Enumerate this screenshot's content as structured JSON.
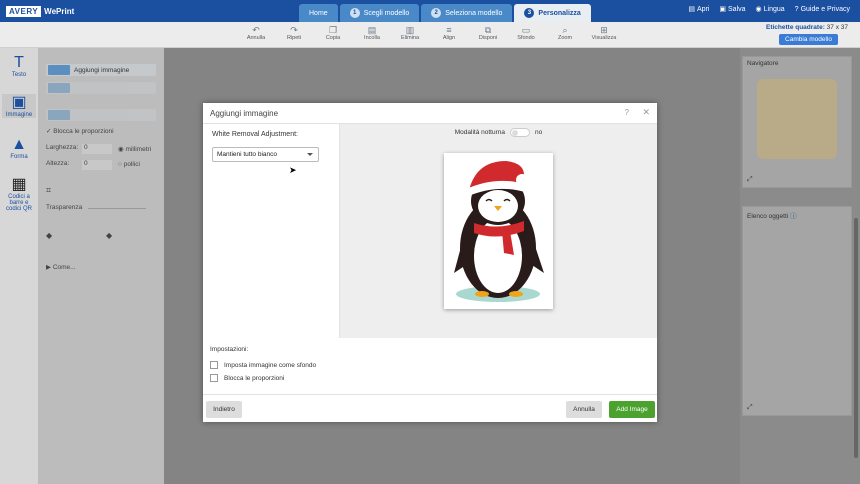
{
  "app": {
    "brand": "AVERY",
    "product": "WePrint"
  },
  "tabs": [
    {
      "label": "Home",
      "num": ""
    },
    {
      "label": "Scegli modello",
      "num": "1"
    },
    {
      "label": "Seleziona modello",
      "num": "2"
    },
    {
      "label": "Personalizza",
      "num": "3"
    }
  ],
  "topnav": {
    "open": "Apri",
    "save": "Salva",
    "language": "Lingua",
    "help": "Guide e Privacy"
  },
  "toolbar": [
    "Annulla",
    "Ripeti",
    "Copia",
    "Incolla",
    "Elimina",
    "Align",
    "Disponi",
    "Sfondo",
    "Zoom",
    "Visualizza"
  ],
  "label_info": {
    "prefix": "Etichette quadrate:",
    "size": "37 x 37"
  },
  "change_template": "Cambia modello",
  "leftbar": {
    "text": "Testo",
    "image": "Immagine",
    "shape": "Forma",
    "qr": "Codici a barre e codici QR"
  },
  "panel": {
    "add_image": "Aggiungi immagine",
    "keep_ratio": "Blocca le proporzioni",
    "width": "Larghezza:",
    "height": "Altezza:",
    "width_val": "0",
    "height_val": "0",
    "unit_mm": "millimetri",
    "unit_in": "pollici",
    "transparency": "Trasparenza",
    "howto": "Come..."
  },
  "right": {
    "navigator": "Navigatore",
    "objects": "Elenco oggetti"
  },
  "modal": {
    "title": "Aggiungi immagine",
    "help": "?",
    "close": "✕",
    "wra_label": "White Removal Adjustment:",
    "wra_value": "Mantieni tutto bianco",
    "night_label": "Modalità notturna",
    "night_value": "no",
    "settings": "Impostazioni:",
    "opt_bg": "Imposta immagine come sfondo",
    "opt_ratio": "Blocca le proporzioni",
    "back": "Indietro",
    "cancel": "Annulla",
    "add": "Add Image"
  }
}
